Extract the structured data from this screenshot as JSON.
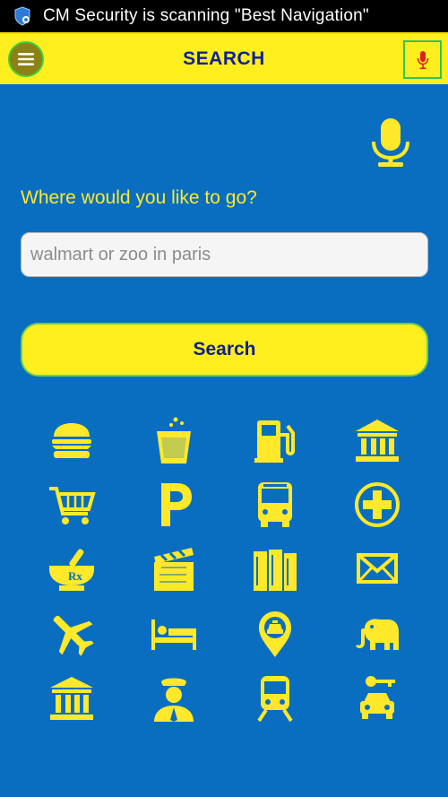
{
  "status_bar": {
    "notification": "CM Security is scanning \"Best Navigation\""
  },
  "app_bar": {
    "title": "SEARCH"
  },
  "main": {
    "prompt": "Where would you like to go?",
    "search_placeholder": "walmart or zoo in paris",
    "search_button": "Search"
  },
  "categories": [
    {
      "icon": "burger-icon"
    },
    {
      "icon": "drink-icon"
    },
    {
      "icon": "gas-station-icon"
    },
    {
      "icon": "bank-icon"
    },
    {
      "icon": "shopping-cart-icon"
    },
    {
      "icon": "parking-icon"
    },
    {
      "icon": "bus-icon"
    },
    {
      "icon": "hospital-icon"
    },
    {
      "icon": "pharmacy-icon"
    },
    {
      "icon": "movie-icon"
    },
    {
      "icon": "library-icon"
    },
    {
      "icon": "post-office-icon"
    },
    {
      "icon": "airport-icon"
    },
    {
      "icon": "hotel-icon"
    },
    {
      "icon": "taxi-icon"
    },
    {
      "icon": "zoo-icon"
    },
    {
      "icon": "museum-icon"
    },
    {
      "icon": "police-icon"
    },
    {
      "icon": "train-icon"
    },
    {
      "icon": "car-rental-icon"
    }
  ],
  "colors": {
    "background": "#0a6ec0",
    "accent": "#ffef1f",
    "text_dark_blue": "#11208a",
    "mic_red": "#e0201e"
  }
}
